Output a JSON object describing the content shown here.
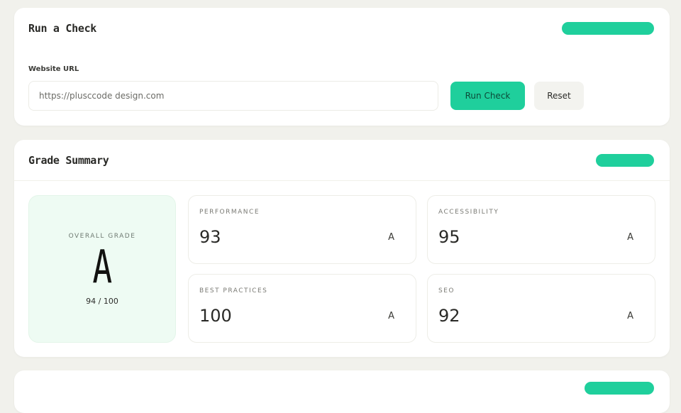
{
  "check": {
    "title": "Run a Check",
    "badge": "",
    "url_label": "Website URL",
    "url_value": "https://plusccode design.com",
    "run_label": "Run Check",
    "reset_label": "Reset"
  },
  "grade": {
    "title": "Grade Summary",
    "badge": "",
    "overall": {
      "label": "OVERALL GRADE",
      "grade": "A",
      "score": "94 / 100"
    },
    "metrics": [
      {
        "label": "PERFORMANCE",
        "value": "93",
        "grade": "A"
      },
      {
        "label": "ACCESSIBILITY",
        "value": "95",
        "grade": "A"
      },
      {
        "label": "BEST PRACTICES",
        "value": "100",
        "grade": "A"
      },
      {
        "label": "SEO",
        "value": "92",
        "grade": "A"
      }
    ]
  },
  "colors": {
    "accent": "#1fcf9c",
    "background": "#f1f1ec",
    "overall_bg": "#eefbf3"
  }
}
